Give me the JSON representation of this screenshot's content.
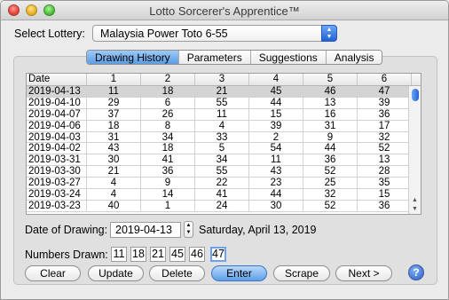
{
  "window": {
    "title": "Lotto Sorcerer's Apprentice™"
  },
  "lottery": {
    "label": "Select Lottery:",
    "value": "Malaysia Power Toto 6-55"
  },
  "tabs": [
    "Drawing History",
    "Parameters",
    "Suggestions",
    "Analysis"
  ],
  "active_tab": "Drawing History",
  "table": {
    "headers": [
      "Date",
      "1",
      "2",
      "3",
      "4",
      "5",
      "6"
    ],
    "rows": [
      [
        "2019-04-13",
        "11",
        "18",
        "21",
        "45",
        "46",
        "47"
      ],
      [
        "2019-04-10",
        "29",
        "6",
        "55",
        "44",
        "13",
        "39"
      ],
      [
        "2019-04-07",
        "37",
        "26",
        "11",
        "15",
        "16",
        "36"
      ],
      [
        "2019-04-06",
        "18",
        "8",
        "4",
        "39",
        "31",
        "17"
      ],
      [
        "2019-04-03",
        "31",
        "34",
        "33",
        "2",
        "9",
        "32"
      ],
      [
        "2019-04-02",
        "43",
        "18",
        "5",
        "54",
        "44",
        "52"
      ],
      [
        "2019-03-31",
        "30",
        "41",
        "34",
        "11",
        "36",
        "13"
      ],
      [
        "2019-03-30",
        "21",
        "36",
        "55",
        "43",
        "52",
        "28"
      ],
      [
        "2019-03-27",
        "4",
        "9",
        "22",
        "23",
        "25",
        "35"
      ],
      [
        "2019-03-24",
        "4",
        "14",
        "41",
        "44",
        "32",
        "15"
      ],
      [
        "2019-03-23",
        "40",
        "1",
        "24",
        "30",
        "52",
        "36"
      ]
    ],
    "selected_row": 0
  },
  "drawing": {
    "label": "Date of Drawing:",
    "date": "2019-04-13",
    "long_date": "Saturday, April 13, 2019"
  },
  "numbers": {
    "label": "Numbers Drawn:",
    "values": [
      "11",
      "18",
      "21",
      "45",
      "46",
      "47"
    ]
  },
  "buttons": {
    "clear": "Clear",
    "update": "Update",
    "delete": "Delete",
    "enter": "Enter",
    "scrape": "Scrape",
    "next": "Next >",
    "help": "?"
  },
  "colors": {
    "accent": "#5b9ce4",
    "selected_row": "#d4d4d4"
  }
}
